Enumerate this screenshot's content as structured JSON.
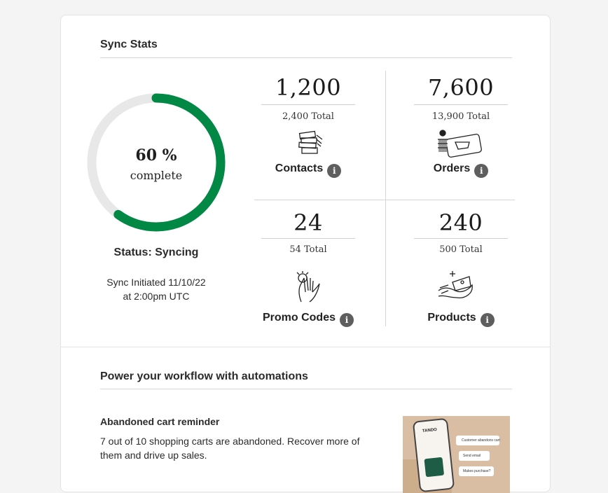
{
  "sync_stats": {
    "title": "Sync Stats",
    "progress": {
      "percent": 60,
      "percent_label": "60 %",
      "sub_label": "complete",
      "color": "#008844",
      "track_color": "#e8e8e8"
    },
    "status": "Status: Syncing",
    "initiated_line1": "Sync Initiated 11/10/22",
    "initiated_line2": "at 2:00pm UTC",
    "stats": [
      {
        "value": "1,200",
        "total": "2,400 Total",
        "label": "Contacts",
        "icon": "contacts-illustration-icon"
      },
      {
        "value": "7,600",
        "total": "13,900 Total",
        "label": "Orders",
        "icon": "orders-illustration-icon"
      },
      {
        "value": "24",
        "total": "54 Total",
        "label": "Promo Codes",
        "icon": "promo-codes-illustration-icon"
      },
      {
        "value": "240",
        "total": "500 Total",
        "label": "Products",
        "icon": "products-illustration-icon"
      }
    ],
    "info_glyph": "i"
  },
  "automations": {
    "title": "Power your workflow with automations",
    "items": [
      {
        "title": "Abandoned cart reminder",
        "description": "7 out of 10 shopping carts are abandoned. Recover more of them and drive up sales.",
        "preview": {
          "brand": "TANDO",
          "steps": [
            "Customer abandons cart",
            "Send email",
            "Makes purchase?"
          ]
        }
      }
    ]
  }
}
